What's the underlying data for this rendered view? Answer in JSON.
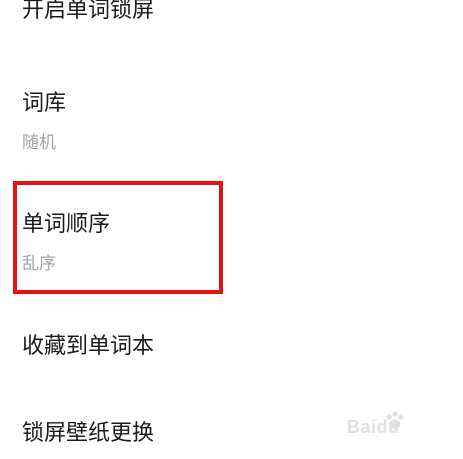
{
  "settings": {
    "items": [
      {
        "title": "开启单词锁屏",
        "subtitle": ""
      },
      {
        "title": "词库",
        "subtitle": "随机"
      },
      {
        "title": "单词顺序",
        "subtitle": "乱序"
      },
      {
        "title": "收藏到单词本",
        "subtitle": ""
      },
      {
        "title": "锁屏壁纸更换",
        "subtitle": ""
      }
    ]
  },
  "annotation": {
    "highlight_color": "#e01414"
  },
  "watermark": {
    "text": "Baidu"
  }
}
